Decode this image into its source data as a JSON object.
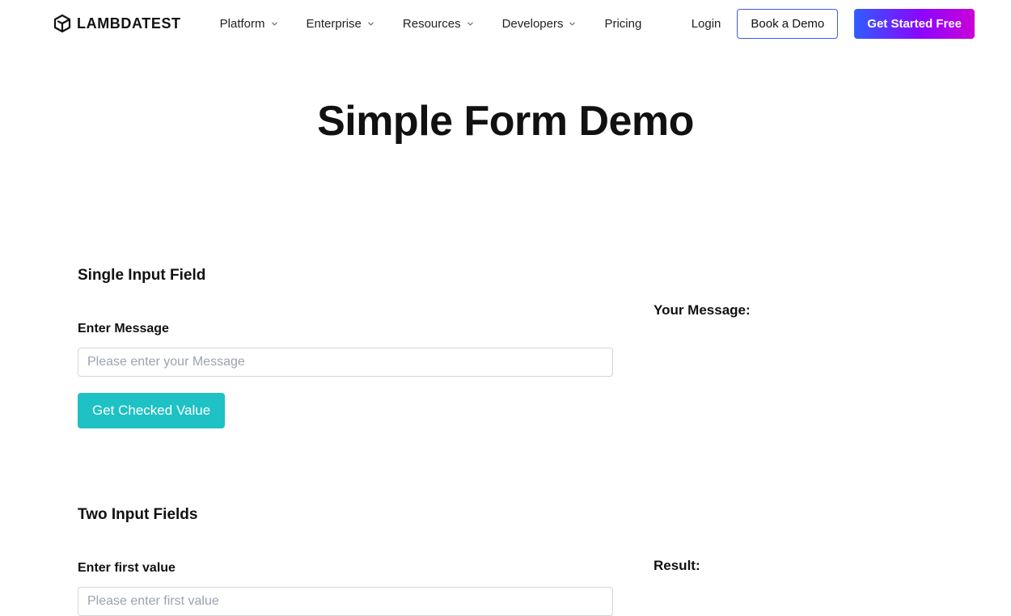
{
  "header": {
    "brand": "LAMBDATEST",
    "nav": [
      {
        "label": "Platform",
        "hasDropdown": true
      },
      {
        "label": "Enterprise",
        "hasDropdown": true
      },
      {
        "label": "Resources",
        "hasDropdown": true
      },
      {
        "label": "Developers",
        "hasDropdown": true
      },
      {
        "label": "Pricing",
        "hasDropdown": false
      }
    ],
    "login": "Login",
    "demo_button": "Book a Demo",
    "started_button": "Get Started Free"
  },
  "page": {
    "title": "Simple Form Demo"
  },
  "section1": {
    "heading": "Single Input Field",
    "label": "Enter Message",
    "placeholder": "Please enter your Message",
    "value": "",
    "button": "Get Checked Value",
    "output_heading": "Your Message:"
  },
  "section2": {
    "heading": "Two Input Fields",
    "label1": "Enter first value",
    "placeholder1": "Please enter first value",
    "value1": "",
    "output_heading": "Result:"
  },
  "colors": {
    "teal": "#1ec1c4",
    "gradient_start": "#2f5dff",
    "gradient_end": "#cb00d7",
    "outline_blue": "#3b5bff"
  }
}
